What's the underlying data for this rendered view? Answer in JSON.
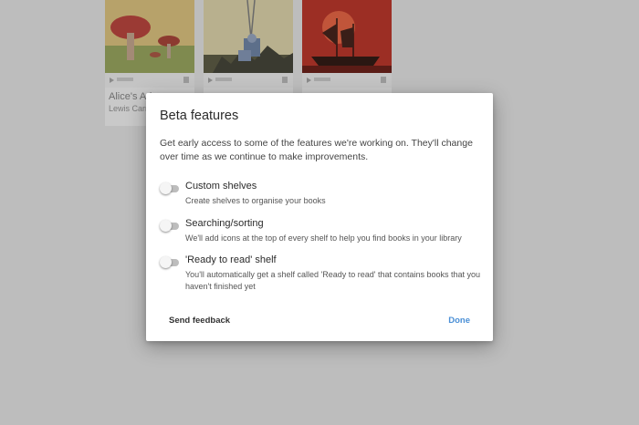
{
  "background": {
    "books": [
      {
        "title": "Alice's Adventures in Wonderland",
        "title_visible": "Alice's Ad",
        "author_visible": "Lewis Carro"
      }
    ]
  },
  "dialog": {
    "title": "Beta features",
    "intro": "Get early access to some of the features we're working on. They'll change over time as we continue to make improvements.",
    "features": [
      {
        "label": "Custom shelves",
        "description": "Create shelves to organise your books",
        "enabled": false
      },
      {
        "label": "Searching/sorting",
        "description": "We'll add icons at the top of every shelf to help you find books in your library",
        "enabled": false
      },
      {
        "label": "'Ready to read' shelf",
        "description": "You'll automatically get a shelf called 'Ready to read' that contains books that you haven't finished yet",
        "enabled": false
      }
    ],
    "send_feedback_label": "Send feedback",
    "done_label": "Done"
  },
  "colors": {
    "accent": "#4a8fd6",
    "backdrop": "#bdbdbd",
    "toggle_off_track": "#bdbdbd"
  }
}
